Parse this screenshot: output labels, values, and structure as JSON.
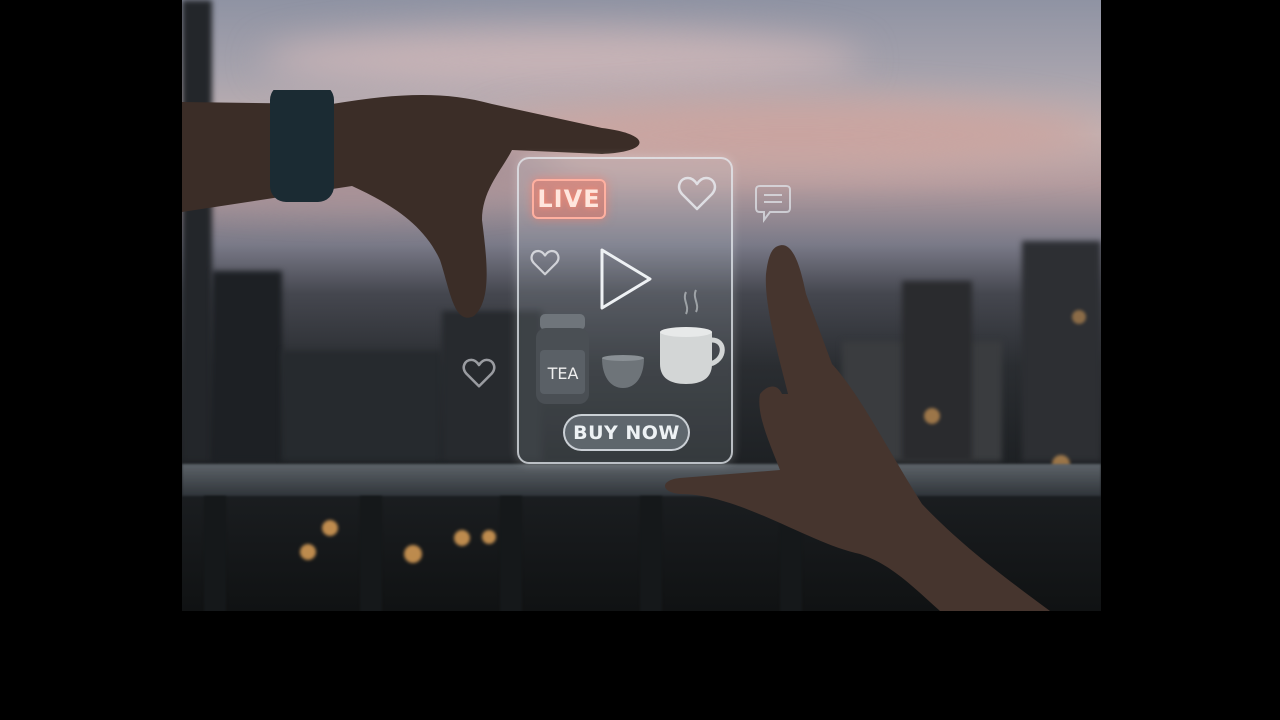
{
  "scene": {
    "live_badge": "LIVE",
    "product_label": "TEA",
    "cta_label": "BUY NOW"
  },
  "icons": {
    "heart": "heart-icon",
    "play": "play-icon",
    "chat": "chat-bubble-icon"
  },
  "colors": {
    "live_accent": "#f06e5a",
    "panel_border": "#e6ebf0",
    "background": "#000000"
  }
}
